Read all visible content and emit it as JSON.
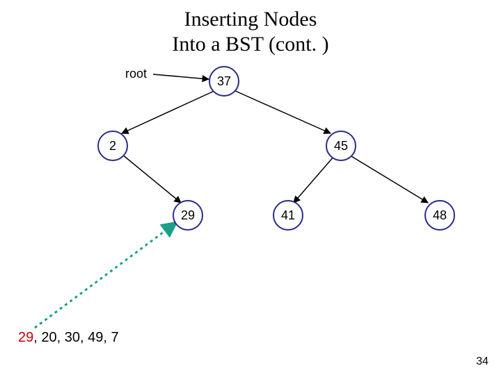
{
  "title_line1": "Inserting Nodes",
  "title_line2": "Into a BST (cont. )",
  "root_label": "root",
  "nodes": {
    "n37": "37",
    "n2": "2",
    "n45": "45",
    "n29": "29",
    "n41": "41",
    "n48": "48"
  },
  "sequence": {
    "highlight": "29",
    "rest": ", 20, 30, 49, 7"
  },
  "page_number": "34"
}
